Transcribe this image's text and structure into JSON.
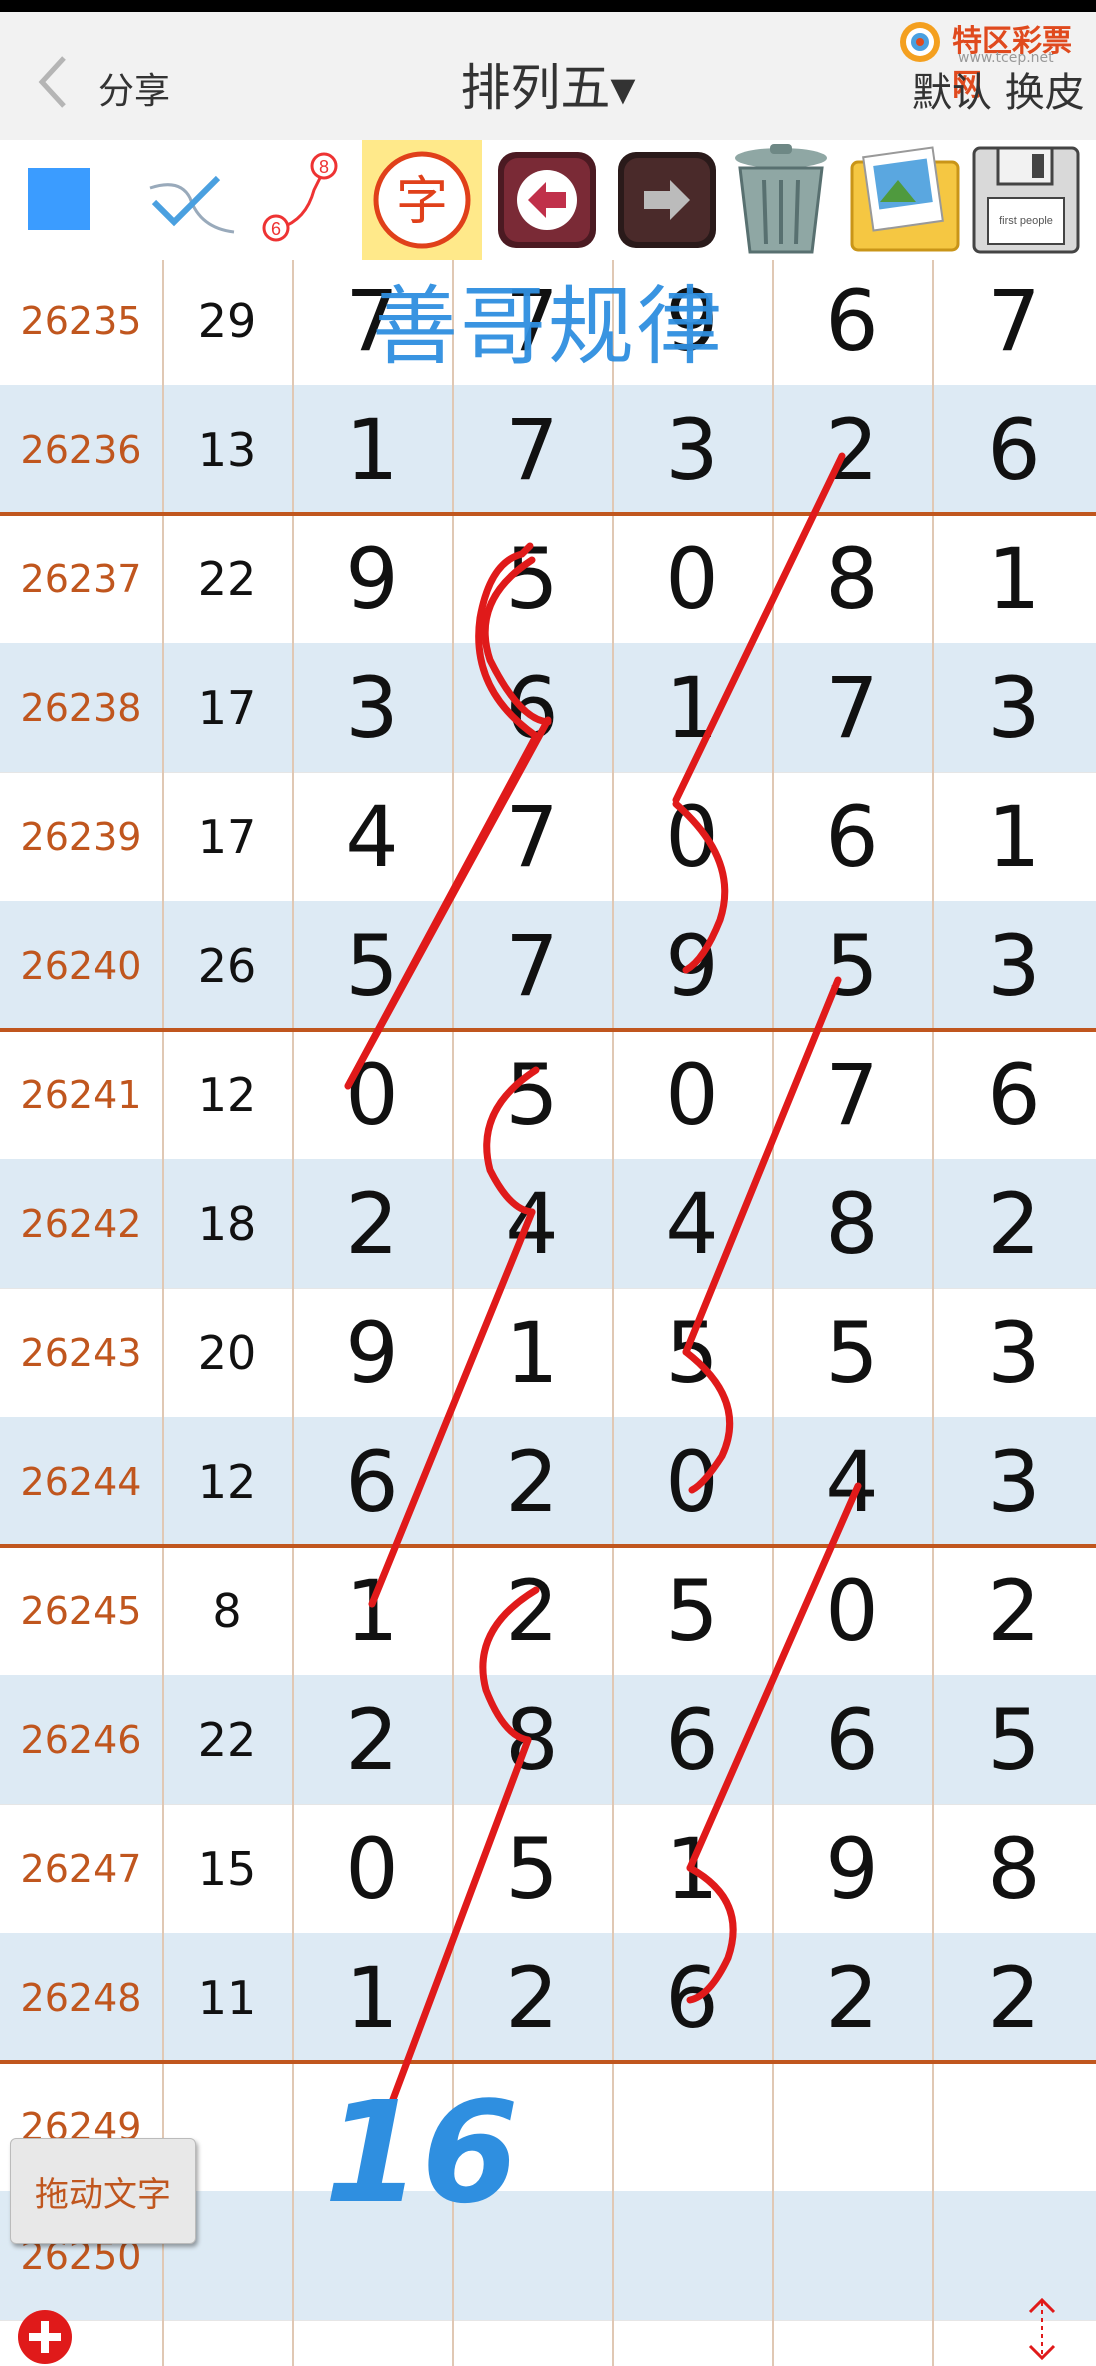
{
  "header": {
    "share_label": "分享",
    "title": "排列五▾",
    "logo_text": "特区彩票网",
    "logo_url": "www.tcep.net",
    "skin_label": "默认 换皮"
  },
  "toolbar": {
    "tools": [
      "color-square",
      "pen",
      "line-6-8",
      "text",
      "undo",
      "redo",
      "trash",
      "image",
      "save"
    ],
    "line_numbers": [
      "8",
      "6"
    ],
    "text_tool_glyph": "字",
    "save_label": "first people"
  },
  "watermark": "善哥规律",
  "hand_number": "16",
  "drag_button_label": "拖动文字",
  "colors": {
    "issue": "#c0561e",
    "row_alt": "#ddeaf4",
    "separator": "#c0561e",
    "ink_red": "#e01a1a",
    "ink_blue": "#2f8fe0"
  },
  "rows": [
    {
      "issue": "26235",
      "sum": "29",
      "d": [
        "7",
        "7",
        "9",
        "6",
        "7"
      ]
    },
    {
      "issue": "26236",
      "sum": "13",
      "d": [
        "1",
        "7",
        "3",
        "2",
        "6"
      ]
    },
    {
      "issue": "26237",
      "sum": "22",
      "d": [
        "9",
        "5",
        "0",
        "8",
        "1"
      ]
    },
    {
      "issue": "26238",
      "sum": "17",
      "d": [
        "3",
        "6",
        "1",
        "7",
        "3"
      ]
    },
    {
      "issue": "26239",
      "sum": "17",
      "d": [
        "4",
        "7",
        "0",
        "6",
        "1"
      ]
    },
    {
      "issue": "26240",
      "sum": "26",
      "d": [
        "5",
        "7",
        "9",
        "5",
        "3"
      ]
    },
    {
      "issue": "26241",
      "sum": "12",
      "d": [
        "0",
        "5",
        "0",
        "7",
        "6"
      ]
    },
    {
      "issue": "26242",
      "sum": "18",
      "d": [
        "2",
        "4",
        "4",
        "8",
        "2"
      ]
    },
    {
      "issue": "26243",
      "sum": "20",
      "d": [
        "9",
        "1",
        "5",
        "5",
        "3"
      ]
    },
    {
      "issue": "26244",
      "sum": "12",
      "d": [
        "6",
        "2",
        "0",
        "4",
        "3"
      ]
    },
    {
      "issue": "26245",
      "sum": "8",
      "d": [
        "1",
        "2",
        "5",
        "0",
        "2"
      ]
    },
    {
      "issue": "26246",
      "sum": "22",
      "d": [
        "2",
        "8",
        "6",
        "6",
        "5"
      ]
    },
    {
      "issue": "26247",
      "sum": "15",
      "d": [
        "0",
        "5",
        "1",
        "9",
        "8"
      ]
    },
    {
      "issue": "26248",
      "sum": "11",
      "d": [
        "1",
        "2",
        "6",
        "2",
        "2"
      ]
    },
    {
      "issue": "26249",
      "sum": "",
      "d": [
        "",
        "",
        "",
        "",
        ""
      ]
    },
    {
      "issue": "26250",
      "sum": "",
      "d": [
        "",
        "",
        "",
        "",
        ""
      ]
    }
  ]
}
